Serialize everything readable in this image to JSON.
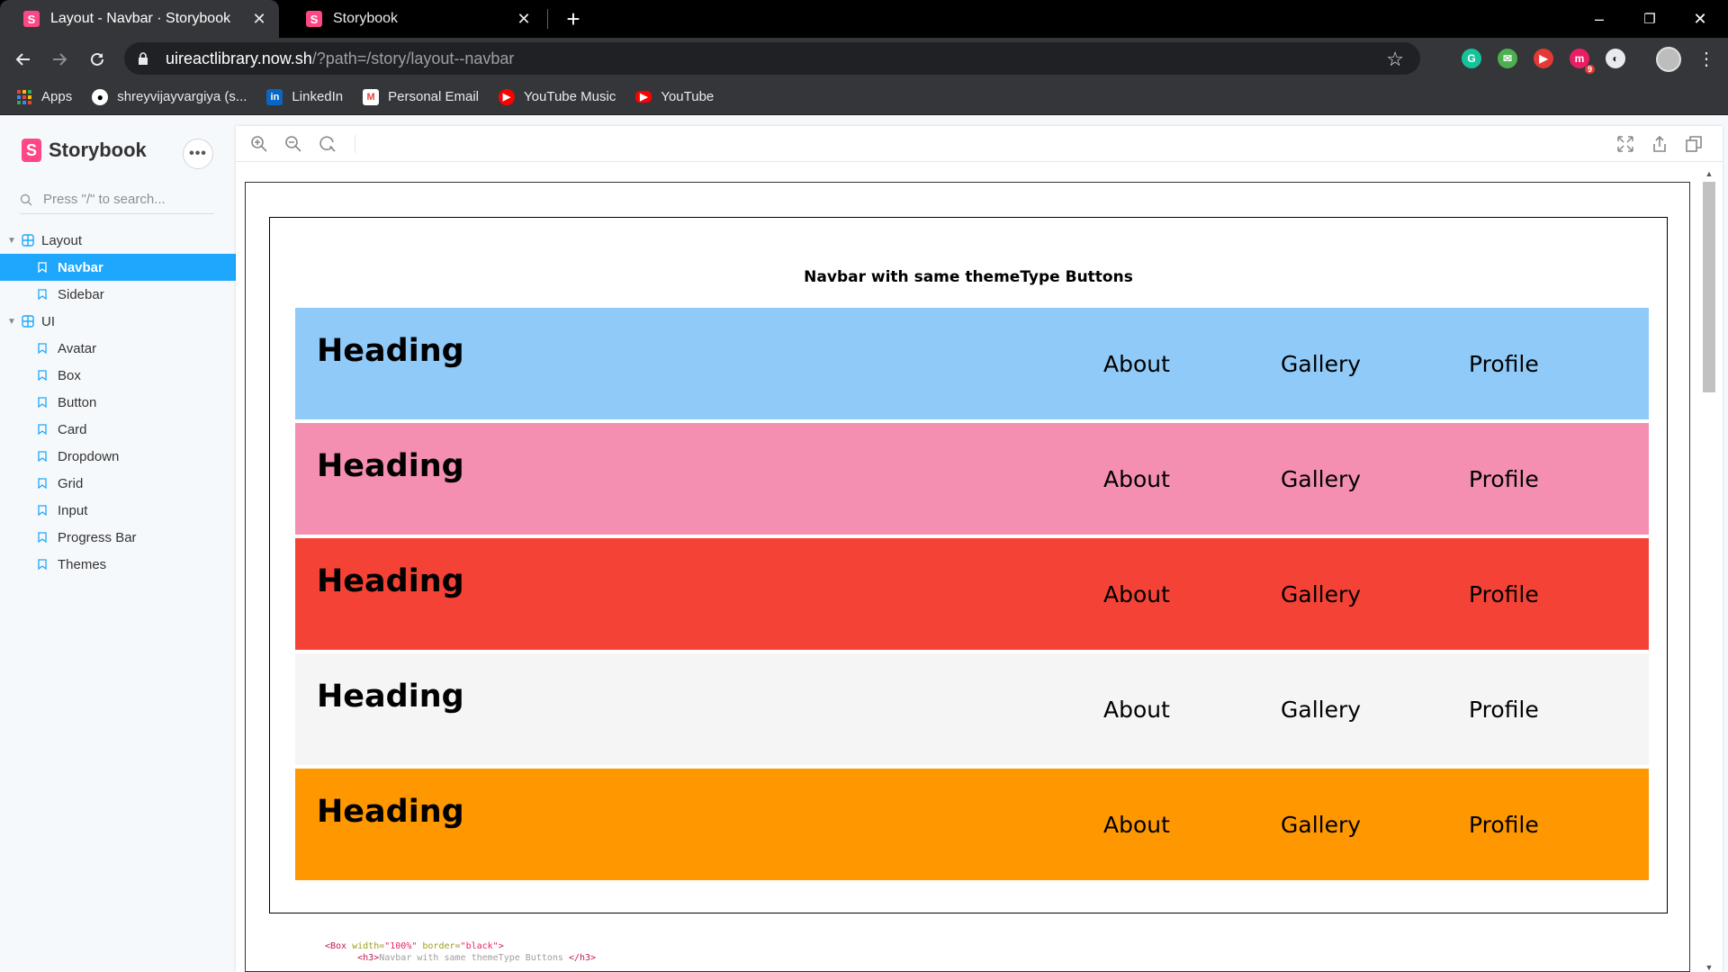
{
  "browser": {
    "tabs": [
      {
        "title": "Layout - Navbar · Storybook",
        "active": true
      },
      {
        "title": "Storybook",
        "active": false
      }
    ],
    "new_tab_glyph": "+",
    "window_controls": {
      "minimize": "–",
      "maximize": "❐",
      "close": "✕"
    },
    "url_host": "uireactlibrary.now.sh",
    "url_path": "/?path=/story/layout--navbar",
    "extensions": [
      {
        "name": "grammarly-icon",
        "color": "#15c39a",
        "glyph": "G"
      },
      {
        "name": "mail-extension-icon",
        "color": "#4caf50",
        "glyph": "✉"
      },
      {
        "name": "video-extension-icon",
        "color": "#e53935",
        "glyph": "▶"
      },
      {
        "name": "m-extension-icon",
        "color": "#e91e63",
        "glyph": "m",
        "badge": "9"
      },
      {
        "name": "circle-extension-icon",
        "color": "#e8eaed",
        "glyph": "◐"
      }
    ],
    "bookmarks": [
      {
        "label": "Apps",
        "icon": "apps-grid-icon"
      },
      {
        "label": "shreyvijayvargiya (s...",
        "icon": "github-icon"
      },
      {
        "label": "LinkedIn",
        "icon": "linkedin-icon"
      },
      {
        "label": "Personal Email",
        "icon": "gmail-icon"
      },
      {
        "label": "YouTube Music",
        "icon": "youtube-music-icon"
      },
      {
        "label": "YouTube",
        "icon": "youtube-icon"
      }
    ]
  },
  "storybook": {
    "brand": "Storybook",
    "menu_glyph": "•••",
    "search_placeholder": "Press \"/\" to search...",
    "tree": [
      {
        "type": "group",
        "label": "Layout",
        "children": [
          {
            "label": "Navbar",
            "selected": true
          },
          {
            "label": "Sidebar",
            "selected": false
          }
        ]
      },
      {
        "type": "group",
        "label": "UI",
        "children": [
          {
            "label": "Avatar"
          },
          {
            "label": "Box"
          },
          {
            "label": "Button"
          },
          {
            "label": "Card"
          },
          {
            "label": "Dropdown"
          },
          {
            "label": "Grid"
          },
          {
            "label": "Input"
          },
          {
            "label": "Progress Bar"
          },
          {
            "label": "Themes"
          }
        ]
      }
    ],
    "accent": "#1ea7fd"
  },
  "preview": {
    "title": "Navbar with same themeType Buttons",
    "navbars": [
      {
        "color": "#90caf9",
        "heading": "Heading",
        "links": [
          "About",
          "Gallery",
          "Profile"
        ]
      },
      {
        "color": "#f48fb1",
        "heading": "Heading",
        "links": [
          "About",
          "Gallery",
          "Profile"
        ]
      },
      {
        "color": "#f44336",
        "heading": "Heading",
        "links": [
          "About",
          "Gallery",
          "Profile"
        ]
      },
      {
        "color": "#f5f5f5",
        "heading": "Heading",
        "links": [
          "About",
          "Gallery",
          "Profile"
        ]
      },
      {
        "color": "#ff9800",
        "heading": "Heading",
        "links": [
          "About",
          "Gallery",
          "Profile"
        ]
      }
    ],
    "code_lines": [
      {
        "tag_open": "<Box",
        "attr1": " width=",
        "val1": "\"100%\"",
        "attr2": " border=",
        "val2": "\"black\"",
        "tag_close": ">"
      },
      {
        "indent": "      ",
        "tag_open": "<h3>",
        "text": "Navbar with same themeType Buttons ",
        "tag_close": "</h3>"
      }
    ]
  }
}
